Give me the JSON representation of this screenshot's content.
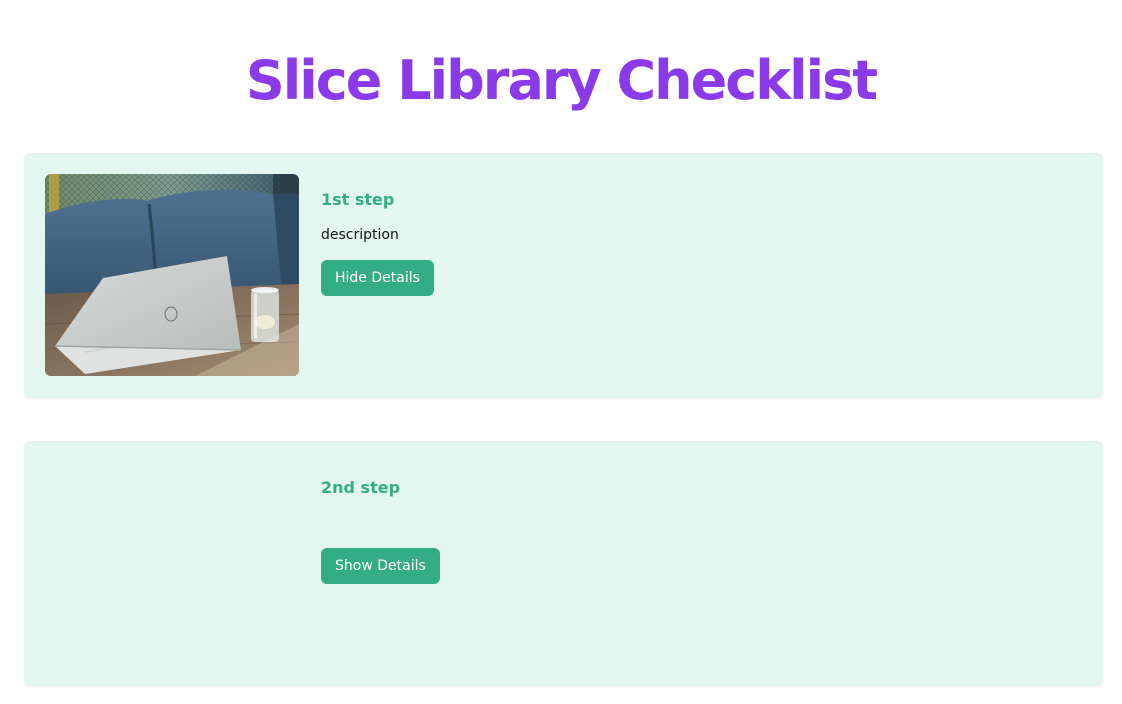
{
  "page": {
    "title": "Slice Library Checklist"
  },
  "colors": {
    "title": "#8a3ae8",
    "card_background": "#e3f6ef",
    "accent": "#33ad85"
  },
  "steps": [
    {
      "title": "1st step",
      "description": "description",
      "button_label": "Hide Details",
      "image": "laptop-on-table-photo"
    },
    {
      "title": "2nd step",
      "button_label": "Show Details"
    }
  ]
}
